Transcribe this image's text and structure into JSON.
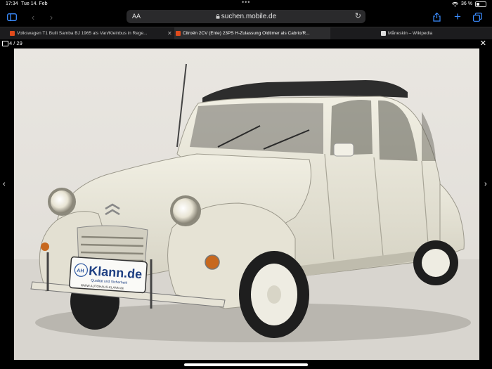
{
  "status_bar": {
    "time": "17:34",
    "date": "Tue 14. Feb",
    "battery": "36 %",
    "battery_level": 0.36,
    "dots": "•••"
  },
  "toolbar": {
    "text_size_label": "AA",
    "url": "suchen.mobile.de",
    "accent_color": "#3a8cff"
  },
  "tabs": [
    {
      "label": "Volkswagen T1 Bulli Samba BJ 1965 als Van/Kleinbus in Rege...",
      "active": false
    },
    {
      "label": "Citroën 2CV (Ente) 23PS H-Zulassung Oldtimer als Cabrio/R...",
      "active": true
    },
    {
      "label": "Måneskin – Wikipedia",
      "active": false
    }
  ],
  "viewer": {
    "counter": "4 / 29"
  },
  "photo": {
    "plate_brand": "Klann.de",
    "plate_prefix": "AH",
    "plate_slogan": "Qualität und Sicherheit!",
    "plate_url": "WWW.AUTOHAUS-KLANN.de",
    "car_color": "#e8e6d8"
  }
}
